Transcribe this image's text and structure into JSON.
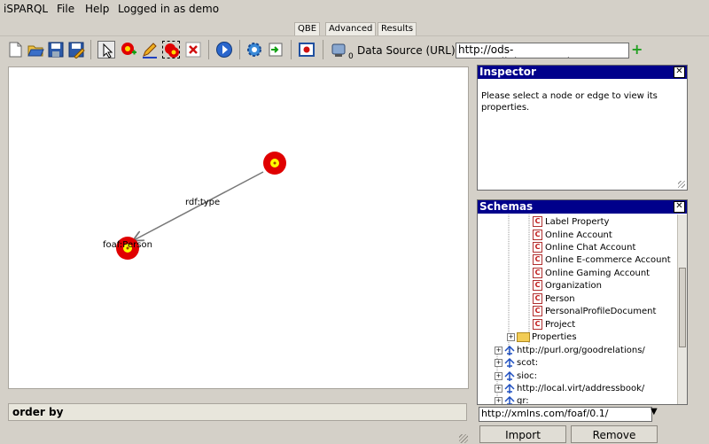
{
  "menubar": {
    "app_title": "iSPARQL",
    "file": "File",
    "help": "Help",
    "login_status": "Logged in as demo"
  },
  "view_tabs": [
    "QBE",
    "Advanced",
    "Results"
  ],
  "toolbar": {
    "icons": [
      "new-file-icon",
      "open-folder-icon",
      "save-icon",
      "save-as-icon",
      "select-arrow-icon",
      "add-node-icon",
      "edit-pencil-icon",
      "group-nodes-icon",
      "delete-icon",
      "run-icon",
      "settings-icon",
      "import-icon",
      "query-icon",
      "dataset-icon"
    ],
    "dataset_count": "0",
    "datasource_label": "Data Source (URL):",
    "datasource_value": "http://ods-qa.openlinksw.com/datasp",
    "add_symbol": "+"
  },
  "canvas": {
    "nodes": [
      {
        "label": "foaf:Person"
      },
      {
        "label": ""
      }
    ],
    "edges": [
      {
        "label": "rdf:type"
      }
    ]
  },
  "order_by": "order by",
  "inspector": {
    "title": "Inspector",
    "message": "Please select a node or edge to view its properties."
  },
  "schemas": {
    "title": "Schemas",
    "class_items": [
      "Label Property",
      "Online Account",
      "Online Chat Account",
      "Online E-commerce Account",
      "Online Gaming Account",
      "Organization",
      "Person",
      "PersonalProfileDocument",
      "Project"
    ],
    "properties_folder": "Properties",
    "namespaces": [
      "http://purl.org/goodrelations/",
      "scot:",
      "sioc:",
      "http://local.virt/addressbook/",
      "gr:"
    ],
    "input_value": "http://xmlns.com/foaf/0.1/",
    "import_label": "Import",
    "remove_label": "Remove"
  },
  "colors": {
    "panel_header": "#00008b",
    "node_outer": "#e00000",
    "node_inner": "#ffff00"
  }
}
